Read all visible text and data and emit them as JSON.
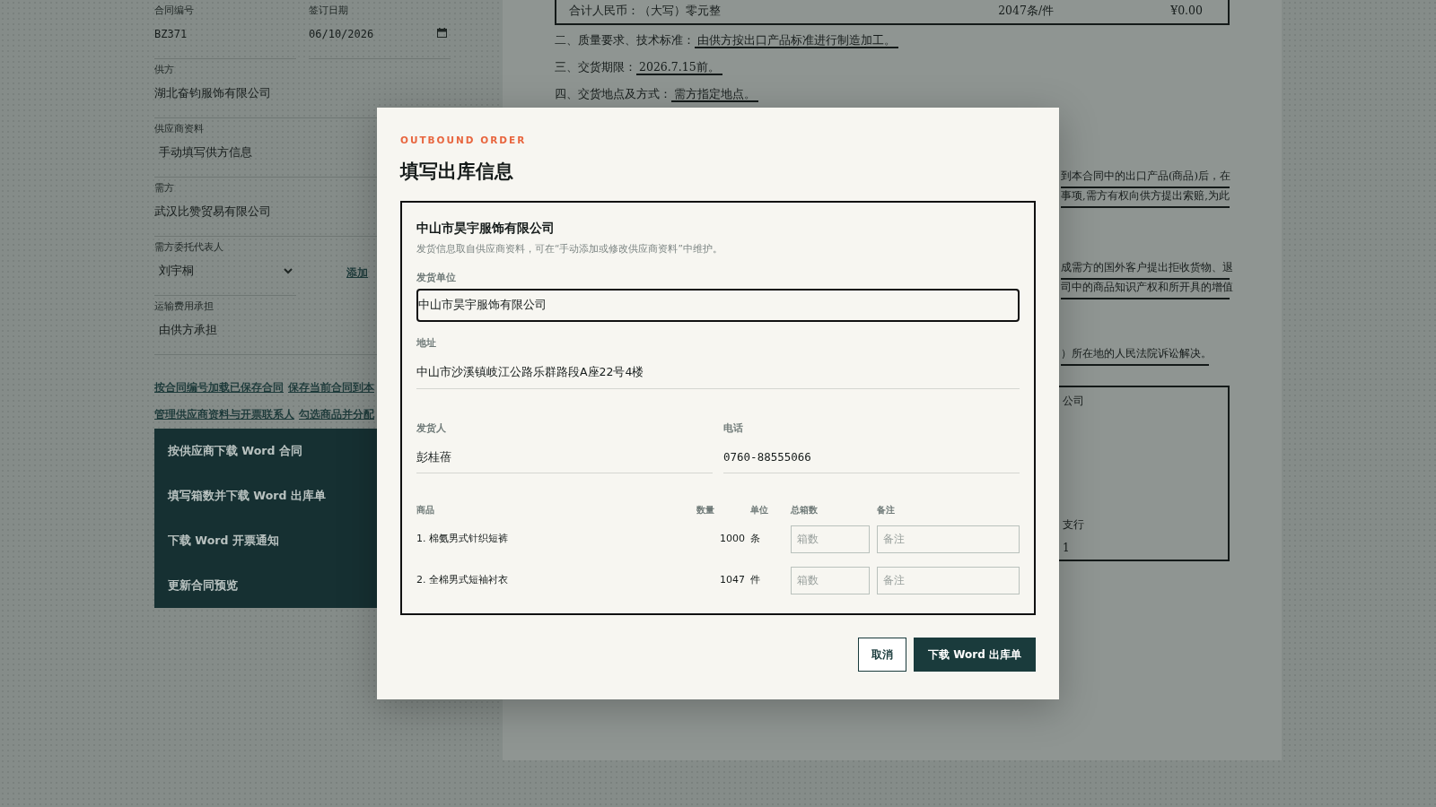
{
  "form": {
    "rows": [
      [
        {
          "kind": "text",
          "label": "合同编号",
          "value": "BZ371",
          "mono": true
        },
        {
          "kind": "date",
          "label": "签订日期",
          "value": "06/10/2026",
          "mono": true
        }
      ],
      [
        {
          "kind": "text",
          "label": "供方",
          "value": "湖北奋钧服饰有限公司"
        }
      ],
      [
        {
          "kind": "select",
          "label": "供应商资料",
          "value": "手动填写供方信息",
          "caret": false
        }
      ],
      [
        {
          "kind": "text",
          "label": "需方",
          "value": "武汉比赞贸易有限公司"
        }
      ],
      [
        {
          "kind": "select",
          "label": "需方委托代表人",
          "value": "刘宇桐",
          "caret": true
        },
        {
          "kind": "link",
          "value": "添加"
        }
      ],
      [
        {
          "kind": "select",
          "label": "运输费用承担",
          "value": "由供方承担",
          "caret": false
        }
      ]
    ],
    "links": [
      [
        "按合同编号加载已保存合同",
        "保存当前合同到本"
      ],
      [
        "管理供应商资料与开票联系人",
        "勾选商品并分配"
      ]
    ],
    "menu": [
      "按供应商下载 Word 合同",
      "填写箱数并下载 Word 出库单",
      "下载 Word 开票通知",
      "更新合同预览"
    ]
  },
  "document": {
    "total_row": {
      "label": "合计人民币：（大写）零元整",
      "quantity": "2047条/件",
      "amount": "¥0.00"
    },
    "clauses": [
      {
        "label": "二、质量要求、技术标准：",
        "value": "由供方按出口产品标准进行制造加工。"
      },
      {
        "label": "三、交货期限：",
        "value": "2026.7.15前。"
      },
      {
        "label": "四、交货地点及方式：",
        "value": "需方指定地点。"
      }
    ],
    "paragraphs": [
      [
        "到本合同中的出口产品(商品)后，在",
        "事项,需方有权向供方提出索赔,为此"
      ],
      [
        "成需方的国外客户提出拒收货物、退",
        "司中的商品知识产权和所开具的增值"
      ],
      [
        "）所在地的人民法院诉讼解决。"
      ]
    ],
    "signature_box": [
      "公司",
      "支行",
      "1"
    ]
  },
  "modal": {
    "eyebrow": "OUTBOUND ORDER",
    "title": "填写出库信息",
    "supplier": {
      "name": "中山市昊宇服饰有限公司",
      "note": "发货信息取自供应商资料，可在“手动添加或修改供应商资料”中维护。"
    },
    "fields": [
      [
        {
          "label": "发货单位",
          "value": "中山市昊宇服饰有限公司",
          "focused": true
        }
      ],
      [
        {
          "label": "地址",
          "value": "中山市沙溪镇岐江公路乐群路段A座22号4楼",
          "focused": false
        }
      ],
      [
        {
          "label": "发货人",
          "value": "彭桂蓓",
          "focused": false
        },
        {
          "label": "电话",
          "value": "0760-88555066",
          "focused": false,
          "mono": true
        }
      ]
    ],
    "table": {
      "columns": [
        "商品",
        "数量",
        "单位",
        "总箱数",
        "备注"
      ],
      "rows": [
        {
          "product": "1. 棉氨男式针织短裤",
          "quantity": "1000",
          "unit": "条",
          "boxes_placeholder": "箱数",
          "note_placeholder": "备注"
        },
        {
          "product": "2. 全棉男式短袖衬衣",
          "quantity": "1047",
          "unit": "件",
          "boxes_placeholder": "箱数",
          "note_placeholder": "备注"
        }
      ]
    },
    "buttons": [
      {
        "label": "取消",
        "kind": "secondary"
      },
      {
        "label": "下载 Word 出库单",
        "kind": "primary"
      }
    ]
  }
}
